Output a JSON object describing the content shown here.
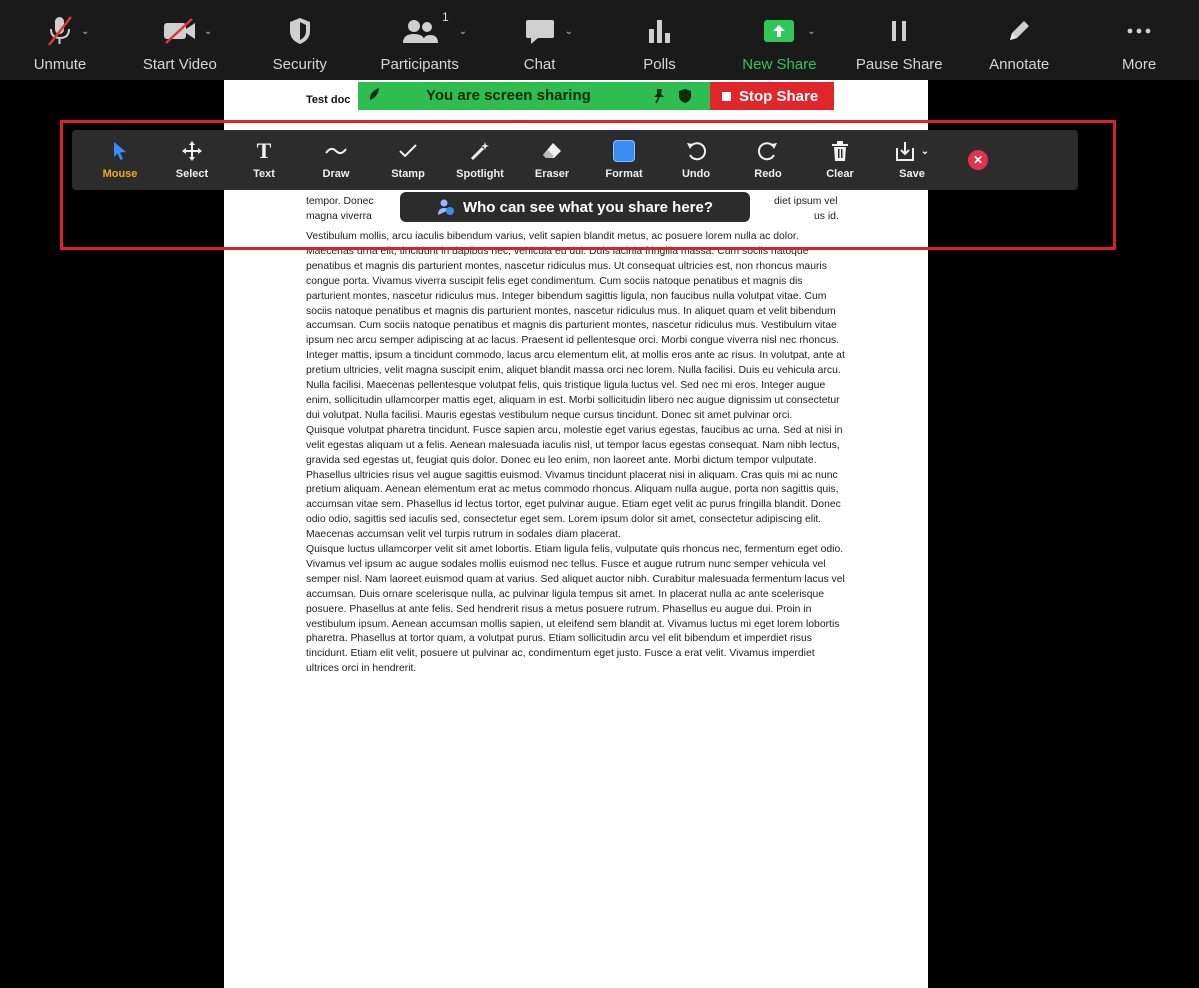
{
  "toolbar": {
    "items": [
      {
        "label": "Unmute",
        "icon": "microphone-muted-icon"
      },
      {
        "label": "Start Video",
        "icon": "video-off-icon"
      },
      {
        "label": "Security",
        "icon": "shield-icon"
      },
      {
        "label": "Participants",
        "icon": "participants-icon",
        "count": "1"
      },
      {
        "label": "Chat",
        "icon": "chat-icon"
      },
      {
        "label": "Polls",
        "icon": "polls-icon"
      },
      {
        "label": "New Share",
        "icon": "share-screen-icon"
      },
      {
        "label": "Pause Share",
        "icon": "pause-icon"
      },
      {
        "label": "Annotate",
        "icon": "pencil-icon"
      },
      {
        "label": "More",
        "icon": "more-icon"
      }
    ],
    "accent": "#2fc65a"
  },
  "banner": {
    "message": "You are screen sharing",
    "stop_label": "Stop Share",
    "green": "#2dbe4f",
    "red": "#e0252b"
  },
  "annotate": {
    "items": [
      {
        "label": "Mouse",
        "icon": "mouse-pointer-icon",
        "active": true
      },
      {
        "label": "Select",
        "icon": "move-arrows-icon"
      },
      {
        "label": "Text",
        "icon": "text-icon"
      },
      {
        "label": "Draw",
        "icon": "draw-wave-icon"
      },
      {
        "label": "Stamp",
        "icon": "checkmark-icon"
      },
      {
        "label": "Spotlight",
        "icon": "magic-wand-icon"
      },
      {
        "label": "Eraser",
        "icon": "eraser-icon"
      },
      {
        "label": "Format",
        "icon": "format-square-icon"
      },
      {
        "label": "Undo",
        "icon": "undo-icon"
      },
      {
        "label": "Redo",
        "icon": "redo-icon"
      },
      {
        "label": "Clear",
        "icon": "trash-icon"
      },
      {
        "label": "Save",
        "icon": "save-download-icon"
      }
    ],
    "active_color": "#f5a623",
    "format_color": "#3a8ef0"
  },
  "tooltip": {
    "text": "Who can see what you share here?"
  },
  "document": {
    "title": "Test doc",
    "visible_fragments": {
      "tempor": "tempor. Donec",
      "right1": "diet ipsum vel",
      "line2_left": "magna viverra",
      "line2_right": "us id."
    },
    "paragraphs": [
      "Vestibulum mollis, arcu iaculis bibendum varius, velit sapien blandit metus, ac posuere lorem nulla ac dolor. Maecenas urna elit, tincidunt in dapibus nec, vehicula eu dui. Duis lacinia fringilla massa. Cum sociis natoque penatibus et magnis dis parturient montes, nascetur ridiculus mus. Ut consequat ultricies est, non rhoncus mauris congue porta. Vivamus viverra suscipit felis eget condimentum. Cum sociis natoque penatibus et magnis dis parturient montes, nascetur ridiculus mus. Integer bibendum sagittis ligula, non faucibus nulla volutpat vitae. Cum sociis natoque penatibus et magnis dis parturient montes, nascetur ridiculus mus. In aliquet quam et velit bibendum accumsan. Cum sociis natoque penatibus et magnis dis parturient montes, nascetur ridiculus mus. Vestibulum vitae ipsum nec arcu semper adipiscing at ac lacus. Praesent id pellentesque orci. Morbi congue viverra nisl nec rhoncus. Integer mattis, ipsum a tincidunt commodo, lacus arcu elementum elit, at mollis eros ante ac risus. In volutpat, ante at pretium ultricies, velit magna suscipit enim, aliquet blandit massa orci nec lorem. Nulla facilisi. Duis eu vehicula arcu. Nulla facilisi. Maecenas pellentesque volutpat felis, quis tristique ligula luctus vel. Sed nec mi eros. Integer augue enim, sollicitudin ullamcorper mattis eget, aliquam in est. Morbi sollicitudin libero nec augue dignissim ut consectetur dui volutpat. Nulla facilisi. Mauris egestas vestibulum neque cursus tincidunt. Donec sit amet pulvinar orci.",
      "Quisque volutpat pharetra tincidunt. Fusce sapien arcu, molestie eget varius egestas, faucibus ac urna. Sed at nisi in velit egestas aliquam ut a felis. Aenean malesuada iaculis nisl, ut tempor lacus egestas consequat. Nam nibh lectus, gravida sed egestas ut, feugiat quis dolor. Donec eu leo enim, non laoreet ante. Morbi dictum tempor vulputate. Phasellus ultricies risus vel augue sagittis euismod. Vivamus tincidunt placerat nisi in aliquam. Cras quis mi ac nunc pretium aliquam. Aenean elementum erat ac metus commodo rhoncus. Aliquam nulla augue, porta non sagittis quis, accumsan vitae sem. Phasellus id lectus tortor, eget pulvinar augue. Etiam eget velit ac purus fringilla blandit. Donec odio odio, sagittis sed iaculis sed, consectetur eget sem. Lorem ipsum dolor sit amet, consectetur adipiscing elit. Maecenas accumsan velit vel turpis rutrum in sodales diam placerat.",
      "Quisque luctus ullamcorper velit sit amet lobortis. Etiam ligula felis, vulputate quis rhoncus nec, fermentum eget odio. Vivamus vel ipsum ac augue sodales mollis euismod nec tellus. Fusce et augue rutrum nunc semper vehicula vel semper nisl. Nam laoreet euismod quam at varius. Sed aliquet auctor nibh. Curabitur malesuada fermentum lacus vel accumsan. Duis ornare scelerisque nulla, ac pulvinar ligula tempus sit amet. In placerat nulla ac ante scelerisque posuere. Phasellus at ante felis. Sed hendrerit risus a metus posuere rutrum. Phasellus eu augue dui. Proin in vestibulum ipsum. Aenean accumsan mollis sapien, ut eleifend sem blandit at. Vivamus luctus mi eget lorem lobortis pharetra. Phasellus at tortor quam, a volutpat purus. Etiam sollicitudin arcu vel elit bibendum et imperdiet risus tincidunt. Etiam elit velit, posuere ut pulvinar ac, condimentum eget justo. Fusce a erat velit. Vivamus imperdiet ultrices orci in hendrerit."
    ]
  }
}
